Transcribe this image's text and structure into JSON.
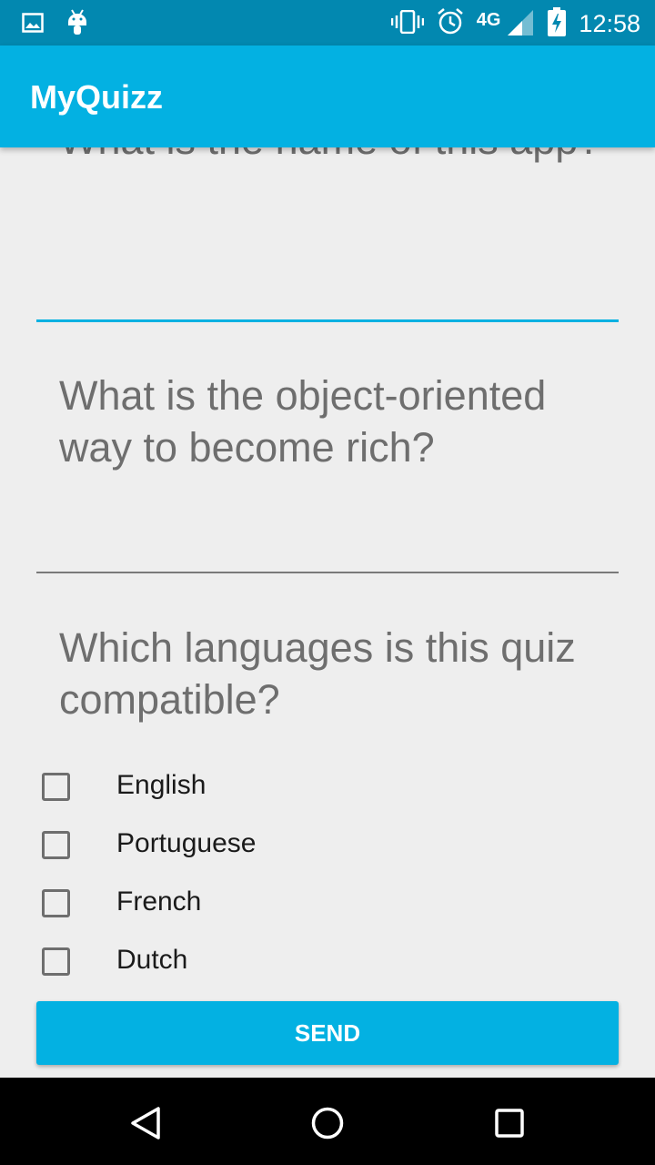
{
  "status_bar": {
    "time": "12:58",
    "network": "4G",
    "icons": [
      "image-notification-icon",
      "android-icon",
      "vibrate-icon",
      "alarm-icon",
      "signal-icon",
      "battery-charging-icon"
    ]
  },
  "app_bar": {
    "title": "MyQuizz"
  },
  "questions": [
    {
      "text": "What is the name of this app?"
    },
    {
      "text": "What is the object-oriented way to become rich?"
    },
    {
      "text": "Which languages is this quiz compatible?"
    }
  ],
  "languages": [
    {
      "label": "English",
      "checked": false
    },
    {
      "label": "Portuguese",
      "checked": false
    },
    {
      "label": "French",
      "checked": false
    },
    {
      "label": "Dutch",
      "checked": false
    }
  ],
  "send_button": {
    "label": "SEND"
  },
  "nav_bar": {
    "buttons": [
      "back-icon",
      "home-icon",
      "recents-icon"
    ]
  },
  "colors": {
    "primary": "#03b1e2",
    "primary_dark": "#0288b0",
    "text_hint": "#6e6e6e"
  }
}
